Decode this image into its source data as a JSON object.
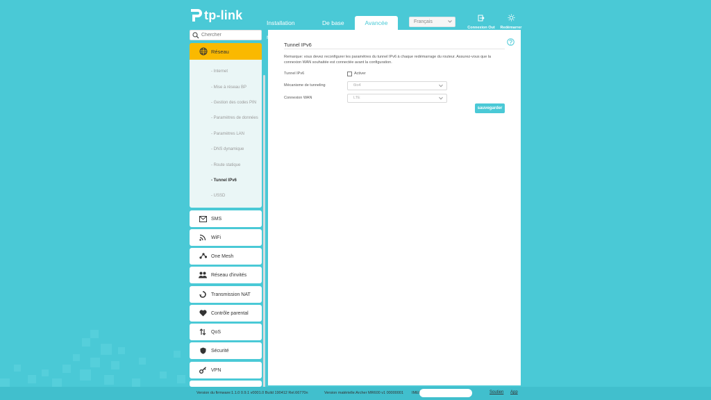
{
  "header": {
    "brand": "tp-link",
    "tabs": {
      "quick_setup": "Installation rapide",
      "basic": "De base",
      "advanced": "Avancée"
    },
    "language": "Français",
    "logout_label": "Connexion Out",
    "reboot_label": "Redémarrer"
  },
  "sidebar": {
    "search_placeholder": "Chercher",
    "active_section": "Réseau",
    "subitems": [
      "- Internet",
      "- Mise à réseau BP",
      "- Gestion des codes PIN",
      "- Paramètres de données",
      "- Paramètres LAN",
      "- DNS dynamique",
      "- Route statique",
      "- Tunnel IPv6",
      "- USSD"
    ],
    "active_subitem_index": 7,
    "sections": [
      {
        "label": "SMS",
        "icon": "envelope-icon"
      },
      {
        "label": "WiFi",
        "icon": "wifi-icon"
      },
      {
        "label": "One Mesh",
        "icon": "mesh-icon"
      },
      {
        "label": "Réseau d'invités",
        "icon": "guest-users-icon"
      },
      {
        "label": "Transmission NAT",
        "icon": "nat-icon"
      },
      {
        "label": "Contrôle parental",
        "icon": "heart-icon"
      },
      {
        "label": "QoS",
        "icon": "qos-arrows-icon"
      },
      {
        "label": "Sécurité",
        "icon": "shield-icon"
      },
      {
        "label": "VPN",
        "icon": "vpn-key-icon"
      }
    ]
  },
  "main": {
    "title": "Tunnel IPv6",
    "note": "Remarque: vous devez reconfigurer les paramètres du tunnel IPv6 à chaque redémarrage du routeur. Assurez-vous que la connexion WAN souhaitée est connectée avant la configuration.",
    "tunnel_label": "Tunnel IPv6",
    "enable_label": "Activer",
    "mechanism_label": "Mécanisme de tunneling",
    "mechanism_value": "6to4",
    "wan_label": "Connexion WAN",
    "wan_value": "LTE",
    "save_label": "sauvegarder"
  },
  "footer": {
    "firmware": "Version du firmware:1.1.0 0.9.1 v0001.0 Build 190412 Rel.66770n",
    "hardware": "Version matérielle:Archer MR600 v1 00000001",
    "imei": "IMEI:",
    "support": "Soutien",
    "app": "App"
  },
  "colors": {
    "accent": "#4ac9d6",
    "active_nav": "#fab900"
  }
}
